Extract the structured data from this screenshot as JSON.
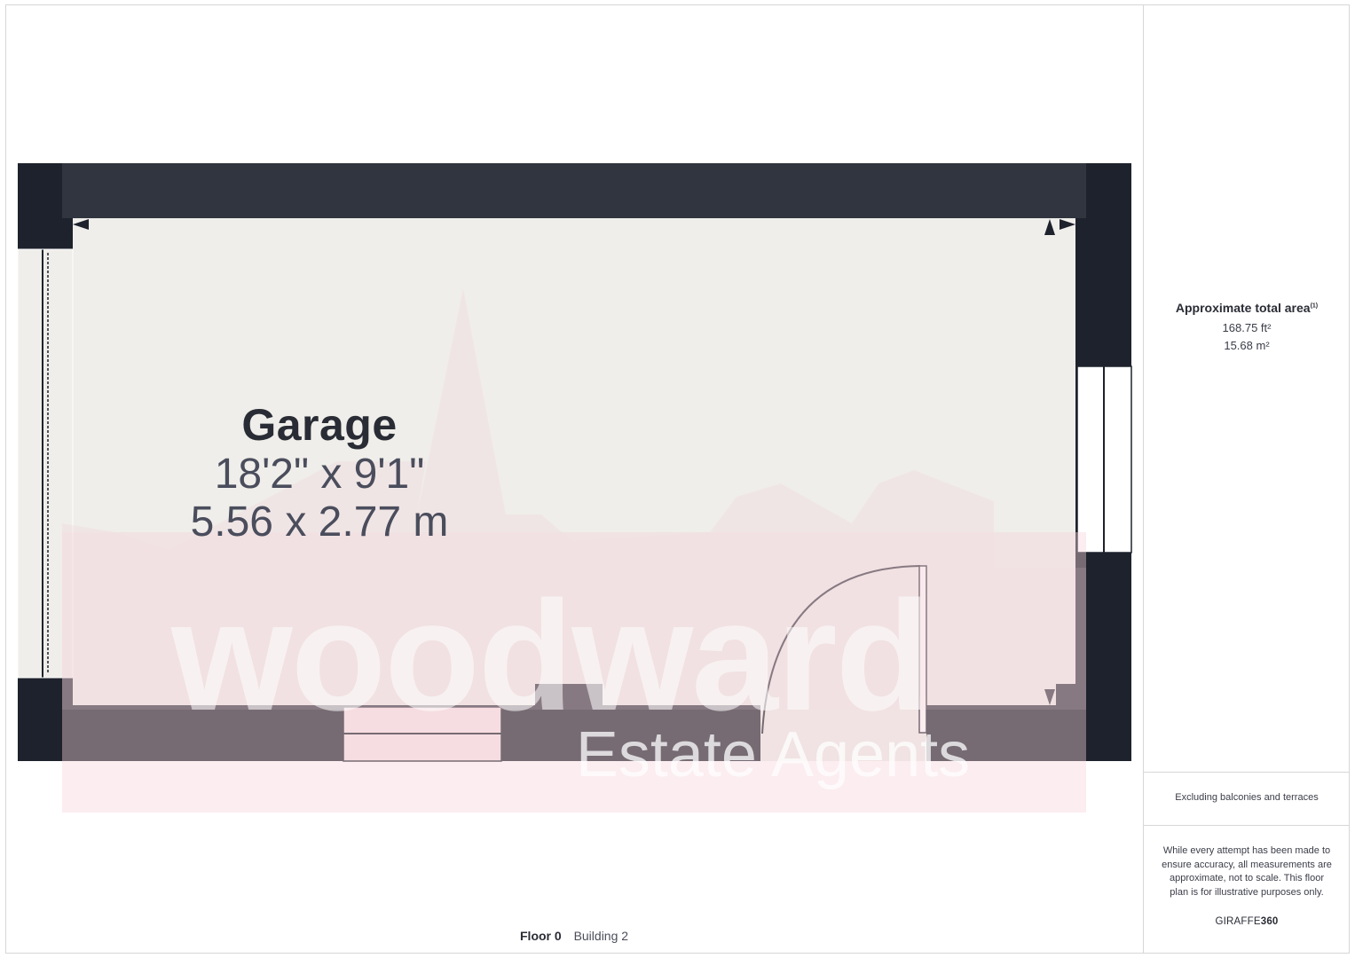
{
  "room": {
    "name": "Garage",
    "dim_imperial": "18'2\" x 9'1\"",
    "dim_metric": "5.56 x 2.77 m"
  },
  "summary": {
    "title": "Approximate total area",
    "footnote_mark": "(1)",
    "area_ft": "168.75 ft²",
    "area_m": "15.68 m²",
    "exclusion_note": "Excluding balconies and terraces",
    "disclaimer": "While every attempt has been made to ensure accuracy, all measurements are approximate, not to scale. This floor plan is for illustrative purposes only.",
    "brand_light": "GIRAFFE",
    "brand_bold": "360"
  },
  "footer": {
    "floor": "Floor 0",
    "building": "Building 2"
  },
  "watermark": {
    "line1": "woodward",
    "line2": "Estate Agents"
  },
  "colors": {
    "wall": "#1e222c",
    "floor": "#efeeea",
    "watermark_tint": "#f4d4da"
  }
}
